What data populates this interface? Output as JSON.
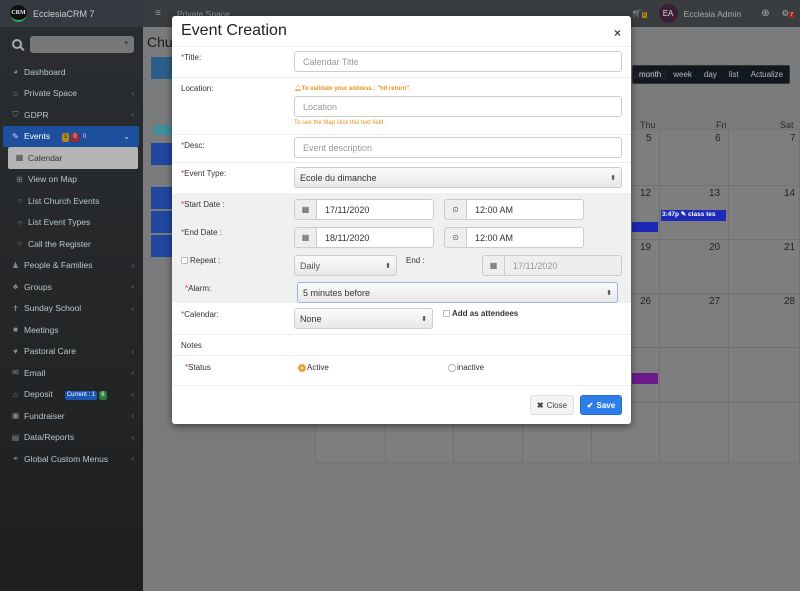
{
  "app": {
    "name": "EcclesiaCRM 7",
    "logo_text": "CRM"
  },
  "sidebar": {
    "search_placeholder": "",
    "items": [
      {
        "label": "Dashboard",
        "icon": "dashboard-icon",
        "glyph": "◕",
        "chevron": false
      },
      {
        "label": "Private Space",
        "icon": "home-icon",
        "glyph": "⌂",
        "chevron": true
      },
      {
        "label": "GDPR",
        "icon": "shield-icon",
        "glyph": "⛉",
        "chevron": true
      },
      {
        "label": "Events",
        "icon": "ticket-icon",
        "glyph": "✎",
        "chevron": true,
        "active": true,
        "badges": [
          "1",
          "0",
          "0"
        ]
      },
      {
        "label": "Calendar",
        "icon": "calendar-icon",
        "glyph": "▦",
        "sub": true,
        "selected": true
      },
      {
        "label": "View on Map",
        "icon": "map-icon",
        "glyph": "⊞",
        "sub": true
      },
      {
        "label": "List Church Events",
        "icon": "circle-icon",
        "glyph": "○",
        "sub": true
      },
      {
        "label": "List Event Types",
        "icon": "circle-icon",
        "glyph": "○",
        "sub": true
      },
      {
        "label": "Call the Register",
        "icon": "circle-icon",
        "glyph": "○",
        "sub": true
      },
      {
        "label": "People & Families",
        "icon": "people-icon",
        "glyph": "♟",
        "chevron": true
      },
      {
        "label": "Groups",
        "icon": "groups-icon",
        "glyph": "♣",
        "chevron": true
      },
      {
        "label": "Sunday School",
        "icon": "child-icon",
        "glyph": "✝",
        "chevron": true
      },
      {
        "label": "Meetings",
        "icon": "video-icon",
        "glyph": "■",
        "chevron": false
      },
      {
        "label": "Pastoral Care",
        "icon": "heart-icon",
        "glyph": "♥",
        "chevron": true
      },
      {
        "label": "Email",
        "icon": "envelope-icon",
        "glyph": "✉",
        "chevron": true
      },
      {
        "label": "Deposit",
        "icon": "bank-icon",
        "glyph": "⌂",
        "chevron": true,
        "badges": [
          "Current : 1",
          "6"
        ]
      },
      {
        "label": "Fundraiser",
        "icon": "money-icon",
        "glyph": "▣",
        "chevron": true
      },
      {
        "label": "Data/Reports",
        "icon": "file-icon",
        "glyph": "▤",
        "chevron": true
      },
      {
        "label": "Global Custom Menus",
        "icon": "link-icon",
        "glyph": "⚭",
        "chevron": true
      }
    ]
  },
  "topbar": {
    "breadcrumb": "Private Space",
    "cart_count": "0",
    "user_initials": "EA",
    "user_name": "Ecclesia Admin",
    "notification_count": "7"
  },
  "page": {
    "title": "Church Calendar"
  },
  "calendar": {
    "view_buttons": [
      "month",
      "week",
      "day",
      "list",
      "Actualize"
    ],
    "active_view": "month",
    "day_names": [
      "Thu",
      "Fri",
      "Sat"
    ],
    "visible_days": [
      [
        "5",
        "6",
        "7"
      ],
      [
        "12",
        "13",
        "14"
      ],
      [
        "19",
        "20",
        "21"
      ],
      [
        "26",
        "27",
        "28"
      ]
    ],
    "events": [
      {
        "label": "3:47p ✎ class tes",
        "color": "#1d2bb8"
      }
    ]
  },
  "modal": {
    "title": "Event Creation",
    "close_icon": "×",
    "fields": {
      "title_label": "Title:",
      "title_placeholder": "Calendar Title",
      "location_label": "Location:",
      "location_hint": "To validate your address : \"hit return\".",
      "location_placeholder": "Location",
      "location_map_hint": "To see the Map click this text field.",
      "desc_label": "Desc:",
      "desc_placeholder": "Event description",
      "event_type_label": "Event Type:",
      "event_type_value": "Ecole du dimanche",
      "start_date_label": "Start Date :",
      "start_date_value": "17/11/2020",
      "start_time_value": "12:00 AM",
      "end_date_label": "End Date :",
      "end_date_value": "18/11/2020",
      "end_time_value": "12:00 AM",
      "repeat_label": "Repeat :",
      "repeat_value": "Daily",
      "repeat_end_label": "End :",
      "repeat_end_value": "17/11/2020",
      "alarm_label": "Alarm:",
      "alarm_value": "5 minutes before",
      "calendar_label": "Calendar:",
      "calendar_value": "None",
      "attendees_label": "Add as attendees",
      "notes_label": "Notes",
      "status_label": "Status",
      "status_active": "Active",
      "status_inactive": "inactive"
    },
    "buttons": {
      "close": "Close",
      "save": "Save"
    },
    "required_mark": "*"
  },
  "colors": {
    "primary": "#2f7ee8",
    "hint": "#e59526",
    "required": "#dd3333"
  }
}
